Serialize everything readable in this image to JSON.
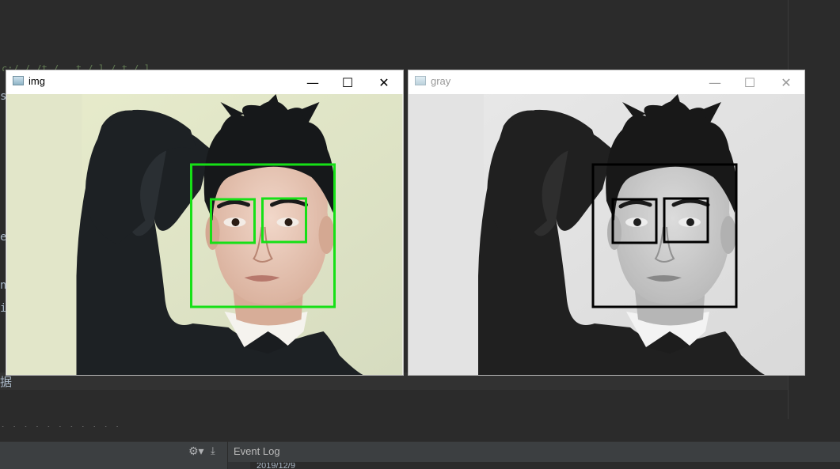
{
  "ide": {
    "side_letters": [
      "s",
      "e",
      "n",
      "i"
    ],
    "chinese_fragment": "据",
    "top_fragment": "c:/   /    /t   /  .  t  /  l  /  t   /  l         ",
    "bottom_fragment": "           .  .  .  .  .  .  .  .  .  .  .",
    "event_log_title": "Event Log",
    "log_date": "2019/12/9",
    "gear_icon": "⚙▾",
    "download_icon": "⤓"
  },
  "windows": [
    {
      "title": "img",
      "mode": "color",
      "box_color": "#16e016",
      "controls": {
        "minimize": "—",
        "maximize": "☐",
        "close": "✕"
      }
    },
    {
      "title": "gray",
      "mode": "grayscale",
      "box_color": "#000000",
      "controls": {
        "minimize": "—",
        "maximize": "☐",
        "close": "✕"
      }
    }
  ],
  "colors": {
    "ide_bg": "#2b2b2b",
    "active_title": "#000000",
    "inactive_title": "#999999"
  }
}
